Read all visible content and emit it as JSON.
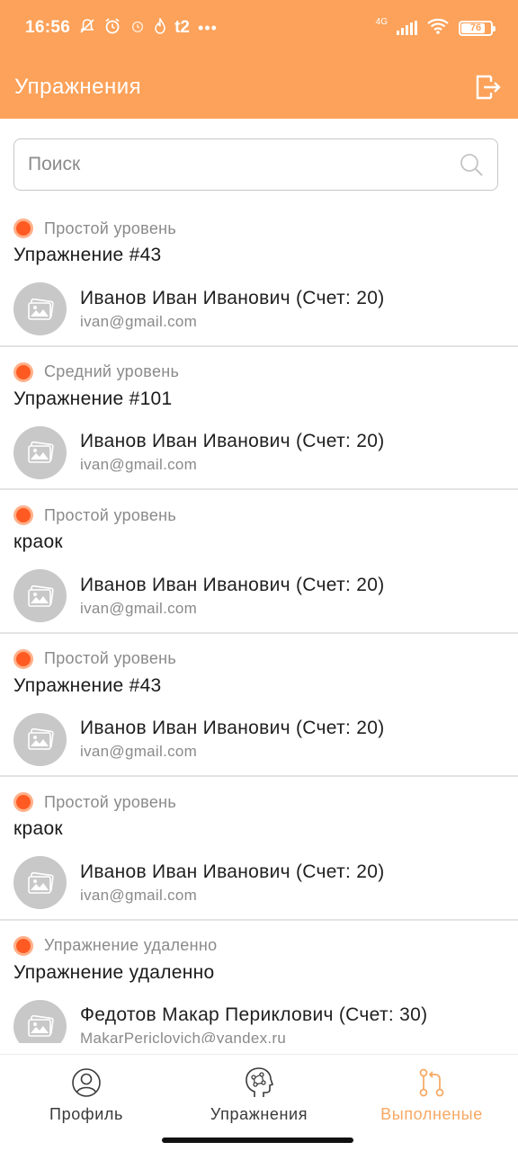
{
  "status_bar": {
    "time": "16:56",
    "icons": [
      "mute-bell-icon",
      "alarm-icon",
      "alarm-outline-icon",
      "flame-icon",
      "t2-carrier-icon",
      "more-dots-icon"
    ],
    "carrier_label": "t2",
    "network": "4G",
    "battery": "76",
    "color": "#ffffff"
  },
  "app_bar": {
    "title": "Упражнения",
    "background": "#fca25a",
    "logout_icon": "logout-icon"
  },
  "search": {
    "placeholder": "Поиск",
    "value": ""
  },
  "exercises": [
    {
      "level": "Простой уровень",
      "title": "Упражнение #43",
      "user_name": "Иванов Иван Иванович (Счет: 20)",
      "user_email": "ivan@gmail.com"
    },
    {
      "level": "Средний уровень",
      "title": "Упражнение #101",
      "user_name": "Иванов Иван Иванович (Счет: 20)",
      "user_email": "ivan@gmail.com"
    },
    {
      "level": "Простой уровень",
      "title": "краок",
      "user_name": "Иванов Иван Иванович (Счет: 20)",
      "user_email": "ivan@gmail.com"
    },
    {
      "level": "Простой уровень",
      "title": "Упражнение #43",
      "user_name": "Иванов Иван Иванович (Счет: 20)",
      "user_email": "ivan@gmail.com"
    },
    {
      "level": "Простой уровень",
      "title": "краок",
      "user_name": "Иванов Иван Иванович (Счет: 20)",
      "user_email": "ivan@gmail.com"
    },
    {
      "level": "Упражнение удаленно",
      "title": "Упражнение удаленно",
      "user_name": "Федотов Макар Периклович (Счет: 30)",
      "user_email": "MakarPericlovich@yandex.ru"
    }
  ],
  "colors": {
    "accent": "#fca25a",
    "level_dot": "#ff5a22",
    "active_nav": "#f7a863"
  },
  "bottom_nav": {
    "items": [
      {
        "label": "Профиль",
        "icon": "profile-icon",
        "active": false
      },
      {
        "label": "Упражнения",
        "icon": "brain-icon",
        "active": false
      },
      {
        "label": "Выполненые",
        "icon": "flow-icon",
        "active": true
      }
    ]
  }
}
